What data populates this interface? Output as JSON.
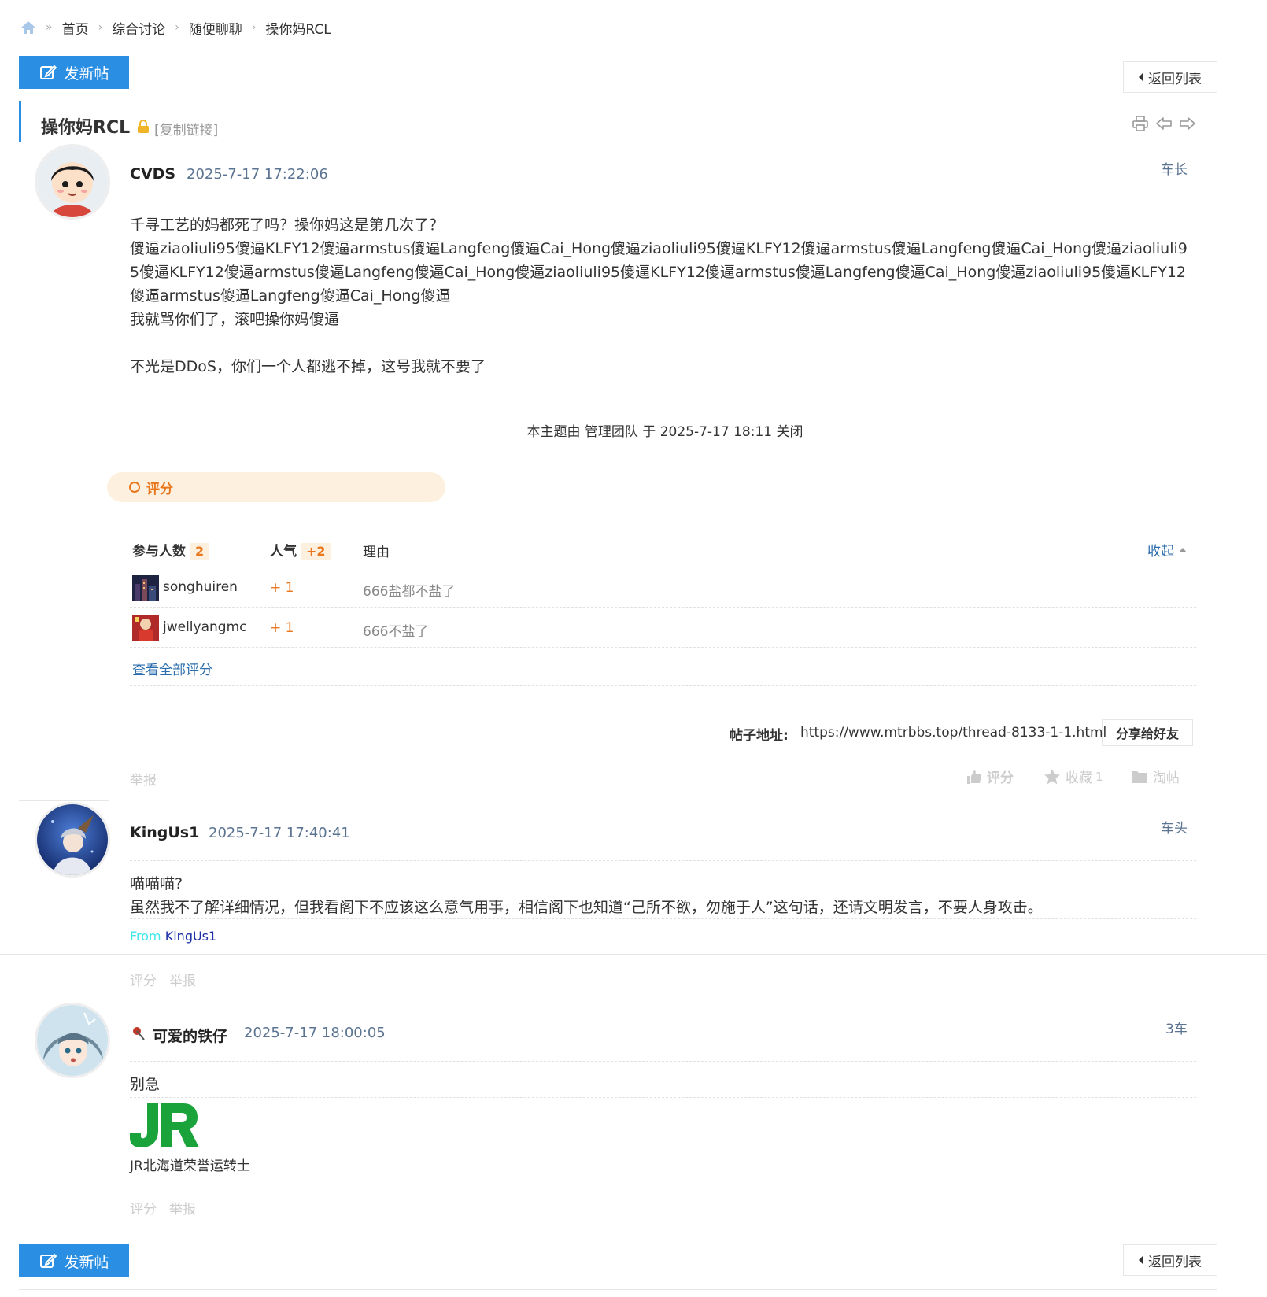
{
  "breadcrumb": {
    "home_icon": "home-icon",
    "items": [
      "首页",
      "综合讨论",
      "随便聊聊",
      "操你妈RCL"
    ]
  },
  "toolbar": {
    "new_post": "发新帖",
    "back_list": "返回列表"
  },
  "thread": {
    "title": "操你妈RCL",
    "copy_link": "[复制链接]"
  },
  "posts": [
    {
      "author": "CVDS",
      "time": "2025-7-17 17:22:06",
      "floor": "车长",
      "lines": [
        "千寻工艺的妈都死了吗？操你妈这是第几次了？",
        "傻逼ziaoliuli95傻逼KLFY12傻逼armstus傻逼Langfeng傻逼Cai_Hong傻逼ziaoliuli95傻逼KLFY12傻逼armstus傻逼Langfeng傻逼Cai_Hong傻逼ziaoliuli95傻逼KLFY12傻逼armstus傻逼Langfeng傻逼Cai_Hong傻逼ziaoliuli95傻逼KLFY12傻逼armstus傻逼Langfeng傻逼Cai_Hong傻逼ziaoliuli95傻逼KLFY12傻逼armstus傻逼Langfeng傻逼Cai_Hong傻逼",
        "我就骂你们了，滚吧操你妈傻逼",
        "",
        "不光是DDoS，你们一个人都逃不掉，这号我就不要了"
      ],
      "closed_note": "本主题由 管理团队 于 2025-7-17 18:11 关闭",
      "rating": {
        "label": "评分",
        "col_participants": "参与人数",
        "participants": "2",
        "col_popularity": "人气",
        "popularity": "+2",
        "col_reason": "理由",
        "collapse": "收起",
        "rows": [
          {
            "user": "songhuiren",
            "score": "+ 1",
            "reason": "666盐都不盐了"
          },
          {
            "user": "jwellyangmc",
            "score": "+ 1",
            "reason": "666不盐了"
          }
        ],
        "view_all": "查看全部评分"
      },
      "share": {
        "label": "帖子地址:",
        "url": "https://www.mtrbbs.top/thread-8133-1-1.html",
        "button": "分享给好友"
      },
      "report": "举报",
      "actions": {
        "rate": "评分",
        "favorite": "收藏",
        "favorite_count": "1",
        "tao": "淘帖"
      }
    },
    {
      "author": "KingUs1",
      "time": "2025-7-17 17:40:41",
      "floor": "车头",
      "lines": [
        "喵喵喵?",
        "虽然我不了解详细情况，但我看阁下不应该这么意气用事，相信阁下也知道“己所不欲，勿施于人”这句话，还请文明发言，不要人身攻击。"
      ],
      "from_label": "From",
      "from_name": "KingUs1",
      "rate": "评分",
      "report": "举报"
    },
    {
      "author": "可爱的铁仔",
      "time": "2025-7-17 18:00:05",
      "floor": "3车",
      "lines": [
        "别急"
      ],
      "signature_logo": "JR",
      "signature": "JR北海道荣誉运转士",
      "rate": "评分",
      "report": "举报"
    }
  ],
  "colors": {
    "accent": "#2a8fe3",
    "orange": "#e9771d",
    "time": "#5b7492",
    "jr_green": "#1aa33b"
  }
}
